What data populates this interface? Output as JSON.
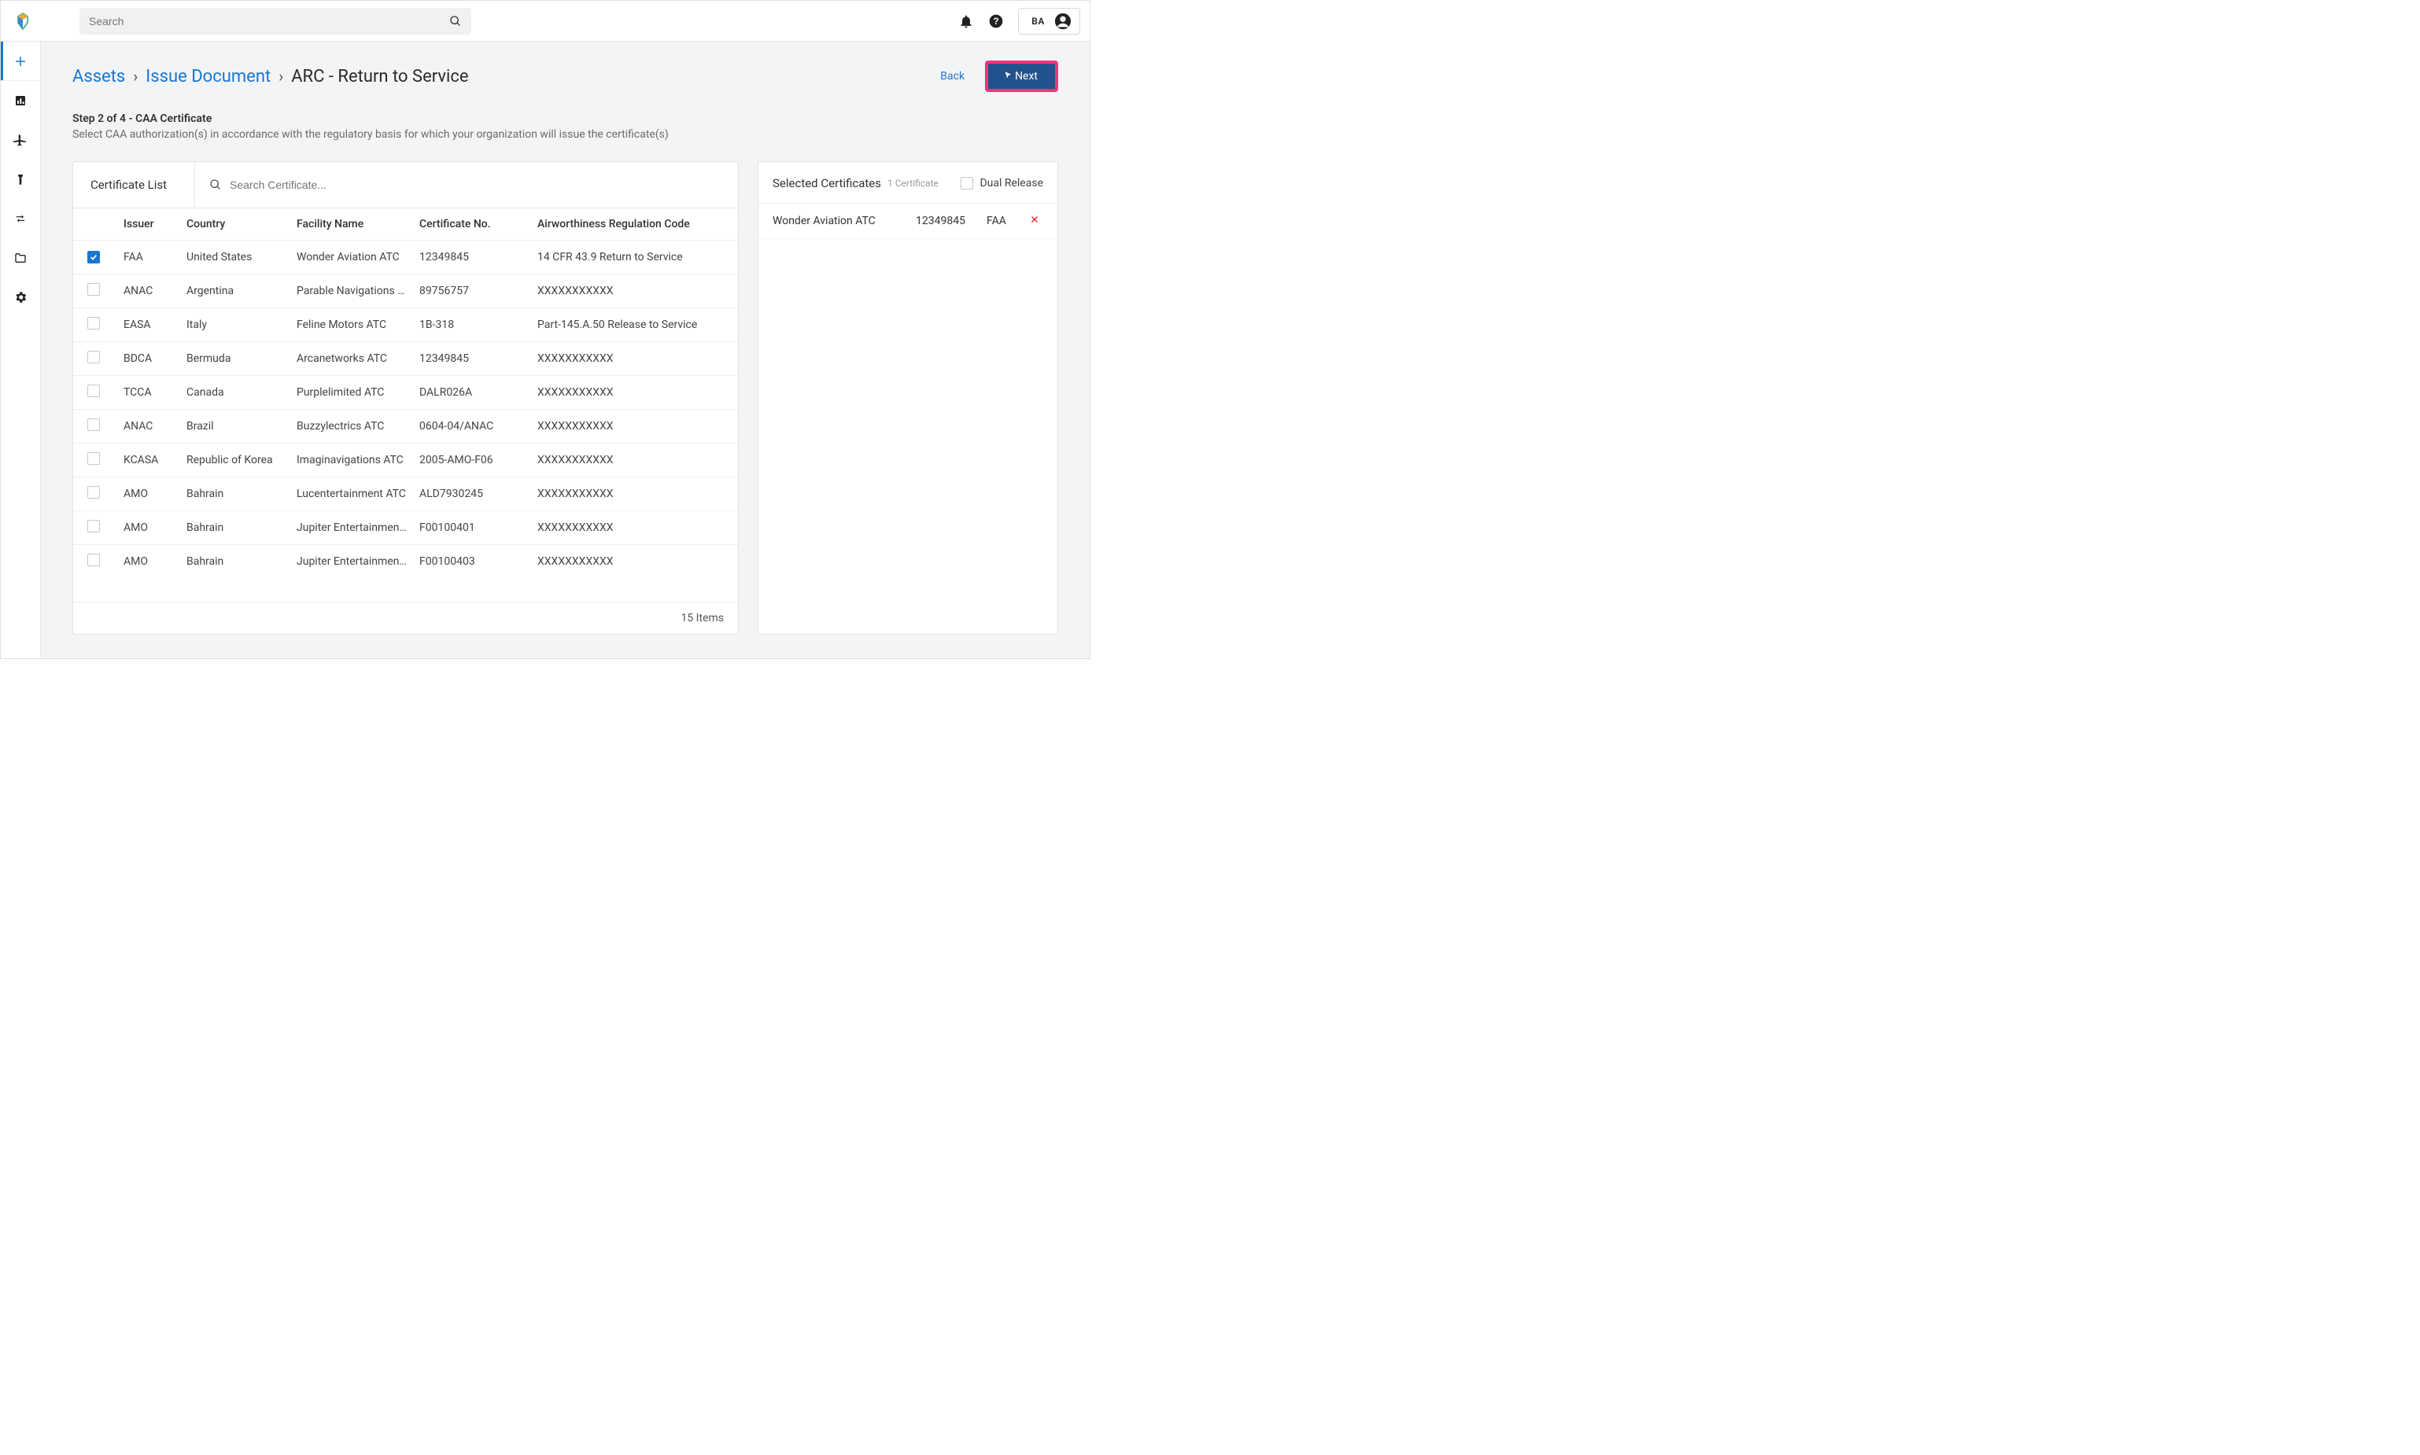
{
  "topbar": {
    "search_placeholder": "Search",
    "user_initials": "BA"
  },
  "breadcrumbs": {
    "assets": "Assets",
    "issue_doc": "Issue Document",
    "current": "ARC - Return to Service",
    "sep": "›"
  },
  "actions": {
    "back": "Back",
    "next": "Next"
  },
  "step": {
    "title": "Step 2 of 4 - CAA Certificate",
    "desc": "Select CAA authorization(s) in accordance with the regulatory basis for which your organization will issue the certificate(s)"
  },
  "cert_panel": {
    "title": "Certificate List",
    "search_placeholder": "Search Certificate...",
    "columns": {
      "issuer": "Issuer",
      "country": "Country",
      "facility": "Facility Name",
      "certno": "Certificate No.",
      "arc": "Airworthiness Regulation Code"
    },
    "rows": [
      {
        "checked": true,
        "issuer": "FAA",
        "country": "United States",
        "facility": "Wonder Aviation ATC",
        "certno": "12349845",
        "arc": "14 CFR 43.9 Return to Service"
      },
      {
        "checked": false,
        "issuer": "ANAC",
        "country": "Argentina",
        "facility": "Parable Navigations A...",
        "certno": "89756757",
        "arc": "XXXXXXXXXXX"
      },
      {
        "checked": false,
        "issuer": "EASA",
        "country": "Italy",
        "facility": "Feline Motors ATC",
        "certno": "1B-318",
        "arc": "Part-145.A.50 Release to Service"
      },
      {
        "checked": false,
        "issuer": "BDCA",
        "country": "Bermuda",
        "facility": "Arcanetworks ATC",
        "certno": "12349845",
        "arc": "XXXXXXXXXXX"
      },
      {
        "checked": false,
        "issuer": "TCCA",
        "country": "Canada",
        "facility": "Purplelimited ATC",
        "certno": "DALR026A",
        "arc": "XXXXXXXXXXX"
      },
      {
        "checked": false,
        "issuer": "ANAC",
        "country": "Brazil",
        "facility": "Buzzylectrics ATC",
        "certno": "0604-04/ANAC",
        "arc": "XXXXXXXXXXX"
      },
      {
        "checked": false,
        "issuer": "KCASA",
        "country": "Republic of Korea",
        "facility": "Imaginavigations ATC",
        "certno": "2005-AMO-F06",
        "arc": "XXXXXXXXXXX"
      },
      {
        "checked": false,
        "issuer": "AMO",
        "country": "Bahrain",
        "facility": "Lucentertainment ATC",
        "certno": "ALD7930245",
        "arc": "XXXXXXXXXXX"
      },
      {
        "checked": false,
        "issuer": "AMO",
        "country": "Bahrain",
        "facility": "Jupiter Entertainment...",
        "certno": "F00100401",
        "arc": "XXXXXXXXXXX"
      },
      {
        "checked": false,
        "issuer": "AMO",
        "country": "Bahrain",
        "facility": "Jupiter Entertainment...",
        "certno": "F00100403",
        "arc": "XXXXXXXXXXX"
      }
    ],
    "footer": "15 Items"
  },
  "selected_panel": {
    "title": "Selected Certificates",
    "count": "1 Certificate",
    "dual_release": "Dual Release",
    "rows": [
      {
        "facility": "Wonder Aviation ATC",
        "certno": "12349845",
        "issuer": "FAA"
      }
    ]
  }
}
